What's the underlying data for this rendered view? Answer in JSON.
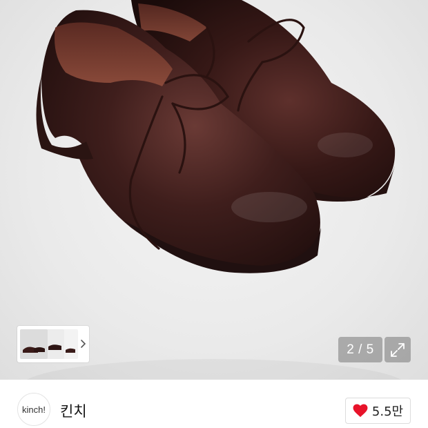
{
  "gallery": {
    "current": "2",
    "total": "5",
    "counter_text": "2 / 5",
    "image_subject": "dark brown leather derby shoes",
    "thumbnail_count": 3
  },
  "shop": {
    "avatar_text": "kinch!",
    "name": "킨치"
  },
  "likes": {
    "count_text": "5.5만",
    "icon": "heart-icon",
    "icon_color": "#e8132a"
  },
  "icons": {
    "next": "chevron-right-icon",
    "fullscreen": "expand-icon"
  }
}
